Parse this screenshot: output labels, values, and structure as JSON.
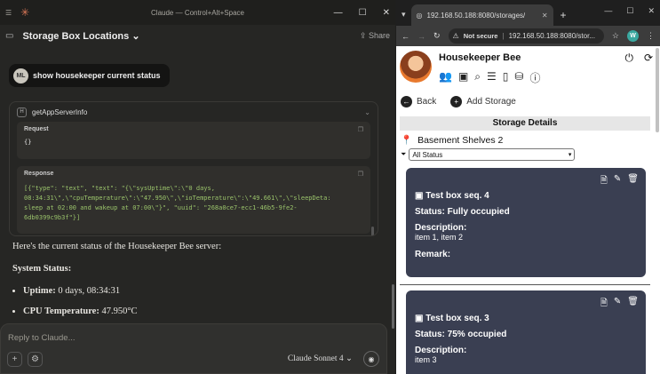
{
  "claude": {
    "window_title": "Claude — Control+Alt+Space",
    "conversation_title": "Storage Box Locations",
    "share_label": "Share",
    "user_initials": "ML",
    "user_message": "show housekeeper current status",
    "tool_name": "getAppServerInfo",
    "request_label": "Request",
    "request_body": "{}",
    "response_label": "Response",
    "response_line1": "[{\"type\": \"text\", \"text\": \"{\\\"sysUptime\\\":\\\"0 days,",
    "response_line2": "08:34:31\\\",\\\"cpuTemperature\\\":\\\"47.950\\\",\\\"ioTemperature\\\":\\\"49.661\\\",\\\"sleepDeta:",
    "response_line3": "sleep at 02:00 and wakeup at 07:00\\\"}\", \"uuid\": \"268a0ce7-ecc1-46b5-9fe2-",
    "response_line4": "6db0399c9b3f\"}]",
    "assistant_intro": "Here's the current status of the Housekeeper Bee server:",
    "system_status_heading": "System Status:",
    "bullets": [
      {
        "label": "Uptime:",
        "value": "0 days, 08:34:31"
      },
      {
        "label": "CPU Temperature:",
        "value": "47.950°C"
      }
    ],
    "composer_placeholder": "Reply to Claude...",
    "model_label": "Claude Sonnet 4"
  },
  "browser": {
    "tab_title": "192.168.50.188:8080/storages/",
    "not_secure": "Not secure",
    "url": "192.168.50.188:8080/stor...",
    "extension_letter": "W"
  },
  "app": {
    "title": "Housekeeper Bee",
    "back_label": "Back",
    "add_storage_label": "Add Storage",
    "section_title": "Storage Details",
    "location": "Basement Shelves 2",
    "filter_value": "All Status",
    "boxes": [
      {
        "title": "Test box seq. 4",
        "status": "Status: Fully occupied",
        "description_label": "Description:",
        "description": "item 1, item 2",
        "remark_label": "Remark:"
      },
      {
        "title": "Test box seq. 3",
        "status": "Status: 75% occupied",
        "description_label": "Description:",
        "description": "item 3"
      }
    ]
  }
}
